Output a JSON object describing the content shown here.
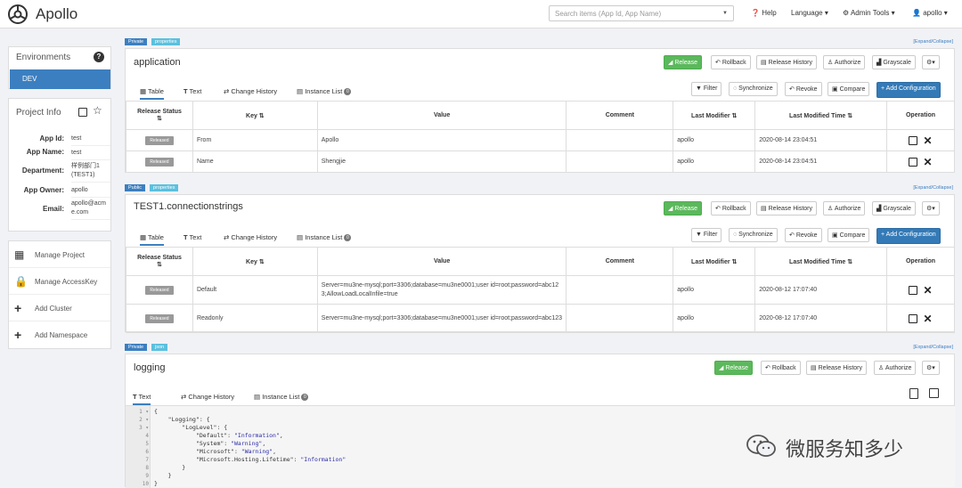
{
  "topbar": {
    "logo_text": "Apollo",
    "search_placeholder": "Search items (App Id, App Name)",
    "help": "Help",
    "language": "Language",
    "admin_tools": "Admin Tools",
    "user": "apollo"
  },
  "sidebar": {
    "environments_title": "Environments",
    "env_selected": "DEV",
    "project_info_title": "Project Info",
    "info": [
      {
        "label": "App Id:",
        "value": "test"
      },
      {
        "label": "App Name:",
        "value": "test"
      },
      {
        "label": "Department:",
        "value": "样例部门1 (TEST1)"
      },
      {
        "label": "App Owner:",
        "value": "apollo"
      },
      {
        "label": "Email:",
        "value": "apollo@acme.com"
      }
    ],
    "nav": [
      {
        "label": "Manage Project",
        "icon": "grid-icon"
      },
      {
        "label": "Manage AccessKey",
        "icon": "lock-icon"
      },
      {
        "label": "Add Cluster",
        "icon": "plus-icon"
      },
      {
        "label": "Add Namespace",
        "icon": "plus-icon"
      }
    ]
  },
  "labels": {
    "expand_collapse": "[Expand/Collapse]",
    "release": "Release",
    "rollback": "Rollback",
    "release_history": "Release History",
    "authorize": "Authorize",
    "grayscale": "Grayscale",
    "filter": "Filter",
    "synchronize": "Synchronize",
    "revoke": "Revoke",
    "compare": "Compare",
    "add_configuration": "+ Add Configuration",
    "tab_table": "Table",
    "tab_text": "Text",
    "tab_change_history": "Change History",
    "tab_instance_list": "Instance List",
    "instance_count": "0",
    "col_release_status": "Release Status",
    "col_key": "Key",
    "col_value": "Value",
    "col_comment": "Comment",
    "col_last_modifier": "Last Modifier",
    "col_last_modified_time": "Last Modified Time",
    "col_operation": "Operation",
    "released": "Released"
  },
  "namespaces": [
    {
      "badge_scope": "Private",
      "badge_format": "properties",
      "name": "application",
      "rows": [
        {
          "key": "From",
          "value": "Apollo",
          "comment": "",
          "modifier": "apollo",
          "time": "2020-08-14 23:04:51"
        },
        {
          "key": "Name",
          "value": "Shengjie",
          "comment": "",
          "modifier": "apollo",
          "time": "2020-08-14 23:04:51"
        }
      ]
    },
    {
      "badge_scope": "Public",
      "badge_format": "properties",
      "name": "TEST1.connectionstrings",
      "rows": [
        {
          "key": "Default",
          "value": "Server=mu3ne-mysql;port=3306;database=mu3ne0001;user id=root;password=abc123;AllowLoadLocalInfile=true",
          "comment": "",
          "modifier": "apollo",
          "time": "2020-08-12 17:07:40"
        },
        {
          "key": "Readonly",
          "value": "Server=mu3ne-mysql;port=3306;database=mu3ne0001;user id=root;password=abc123",
          "comment": "",
          "modifier": "apollo",
          "time": "2020-08-12 17:07:40"
        }
      ]
    },
    {
      "badge_scope": "Private",
      "badge_format": "json",
      "name": "logging",
      "code_lines": [
        "{",
        "    \"Logging\": {",
        "        \"LogLevel\": {",
        "            \"Default\": \"Information\",",
        "            \"System\": \"Warning\",",
        "            \"Microsoft\": \"Warning\",",
        "            \"Microsoft.Hosting.Lifetime\": \"Information\"",
        "        }",
        "    }",
        "}"
      ]
    }
  ],
  "watermark": "微服务知多少",
  "colors": {
    "primary": "#3c7fc0",
    "release": "#5cb85c",
    "add": "#337ab7",
    "private_badge": "#3c7fc0",
    "format_badge": "#5bc0de"
  }
}
